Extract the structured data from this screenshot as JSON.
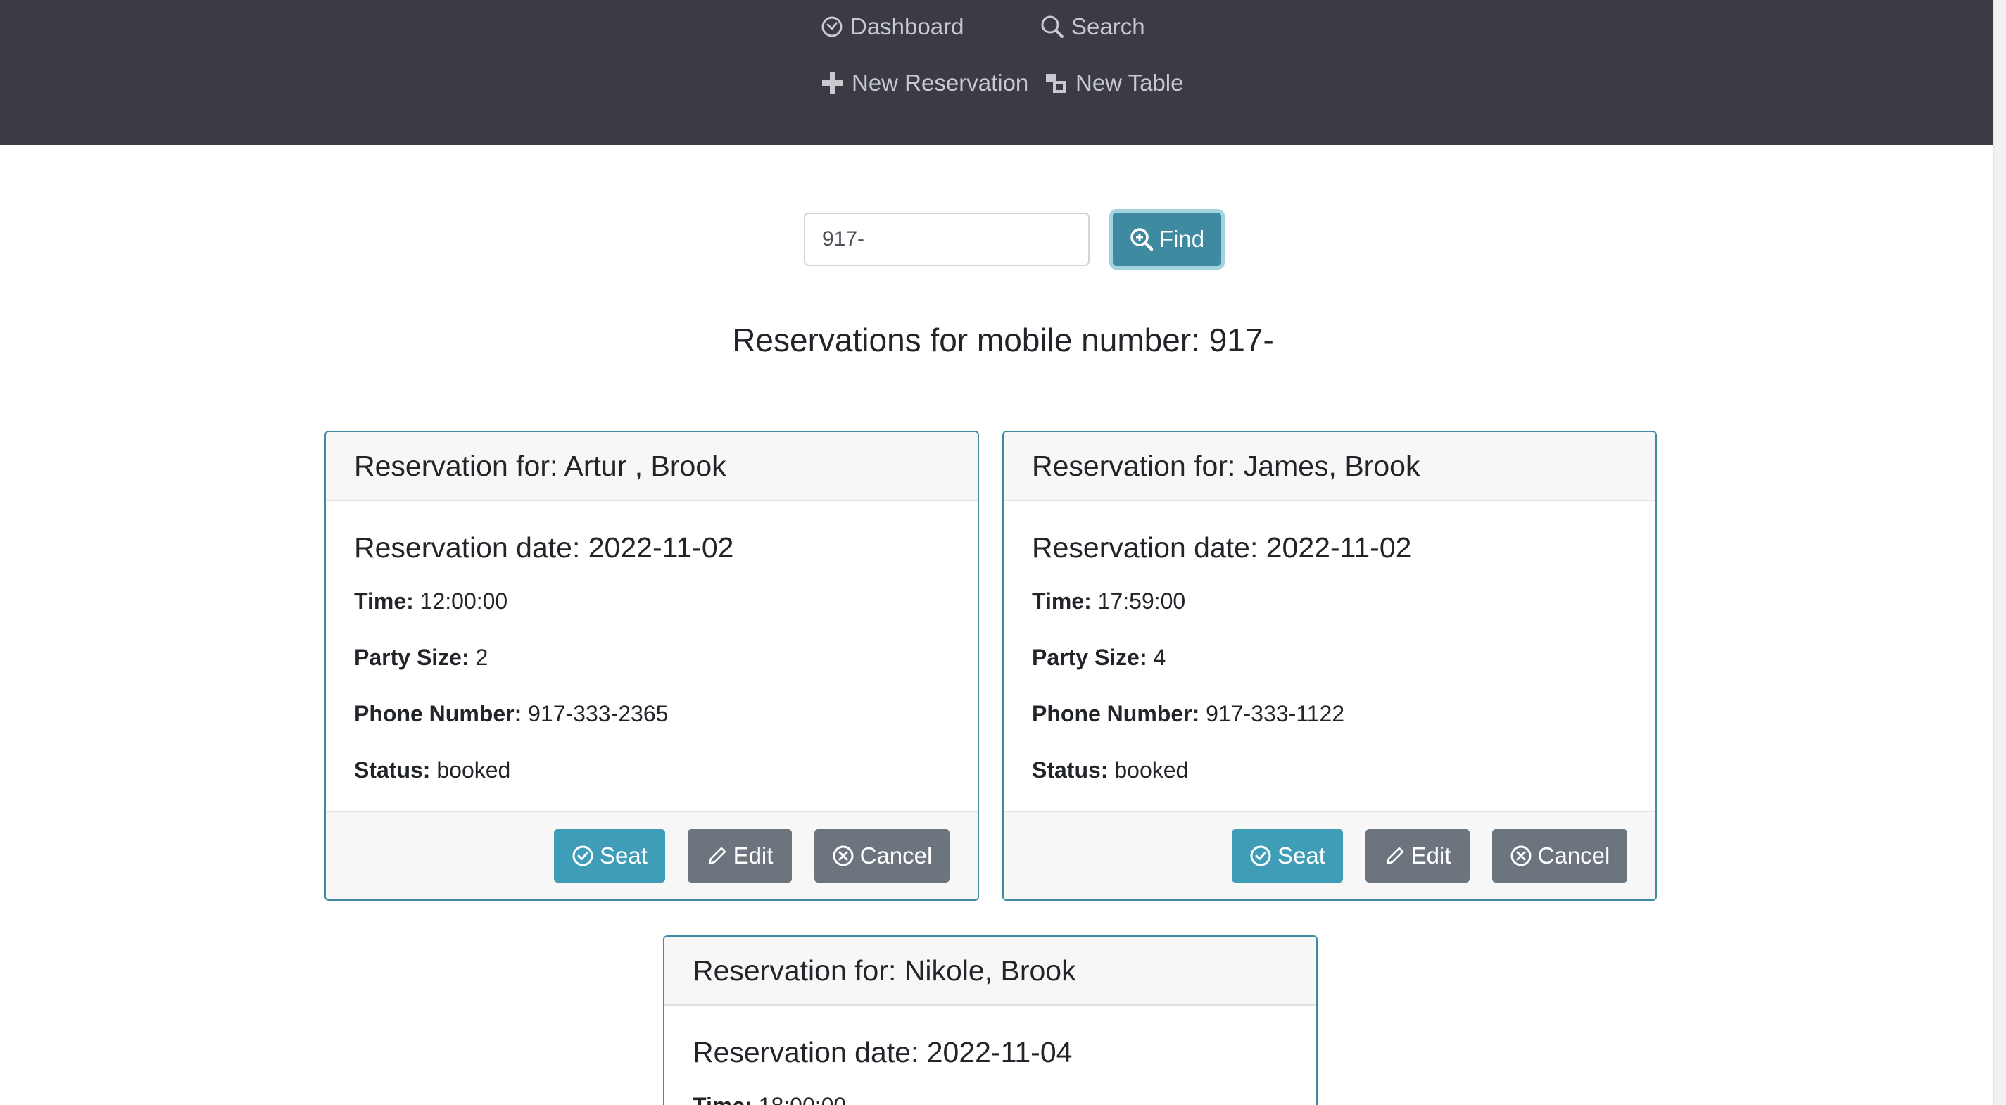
{
  "nav": {
    "dashboard": "Dashboard",
    "search": "Search",
    "new_reservation": "New Reservation",
    "new_table": "New Table"
  },
  "search": {
    "value": "917-",
    "find_label": "Find"
  },
  "results_heading": "Reservations for mobile number: 917-",
  "labels": {
    "time": "Time:",
    "party_size": "Party Size:",
    "phone": "Phone Number:",
    "status": "Status:",
    "seat": "Seat",
    "edit": "Edit",
    "cancel": "Cancel"
  },
  "reservations": [
    {
      "header": "Reservation for: Artur , Brook",
      "date": "Reservation date: 2022-11-02",
      "time": "12:00:00",
      "party_size": "2",
      "phone": "917-333-2365",
      "status": "booked"
    },
    {
      "header": "Reservation for: James, Brook",
      "date": "Reservation date: 2022-11-02",
      "time": "17:59:00",
      "party_size": "4",
      "phone": "917-333-1122",
      "status": "booked"
    },
    {
      "header": "Reservation for: Nikole, Brook",
      "date": "Reservation date: 2022-11-04",
      "time": "18:00:00"
    }
  ],
  "colors": {
    "nav_bg": "#3a3b44",
    "accent": "#3e8aa1",
    "seat_button": "#3f9db8",
    "secondary_button": "#6c757d"
  },
  "icons": {
    "dashboard": "dashboard-icon",
    "search": "search-icon",
    "new_reservation": "plus-icon",
    "new_table": "table-icon",
    "find": "zoom-in-icon",
    "seat": "check-circle-icon",
    "edit": "pencil-icon",
    "cancel": "x-circle-icon"
  }
}
